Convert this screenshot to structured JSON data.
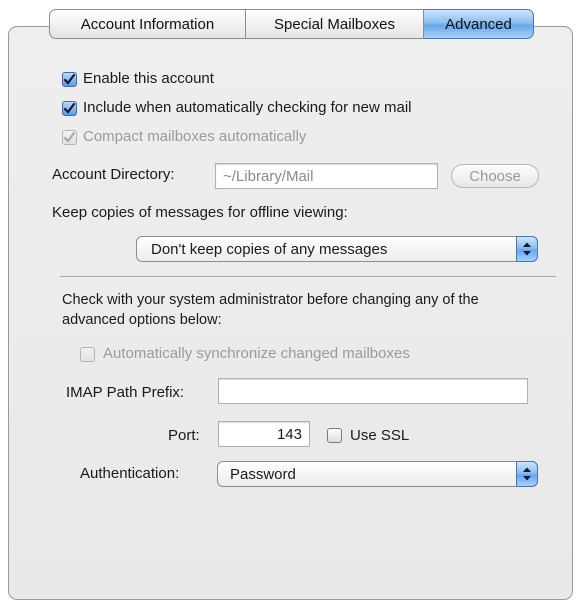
{
  "tabs": [
    {
      "label": "Account Information",
      "active": false
    },
    {
      "label": "Special Mailboxes",
      "active": false
    },
    {
      "label": "Advanced",
      "active": true
    }
  ],
  "options": {
    "enable_account": {
      "label": "Enable this account",
      "checked": true
    },
    "include_auto_check": {
      "label": "Include when automatically checking for new mail",
      "checked": true
    },
    "compact_mailboxes": {
      "label": "Compact mailboxes automatically",
      "checked": true,
      "disabled": true
    }
  },
  "account_directory": {
    "label": "Account Directory:",
    "value": "~/Library/Mail",
    "choose_button": "Choose"
  },
  "offline": {
    "label": "Keep copies of messages for offline viewing:",
    "selected": "Don't keep copies of any messages"
  },
  "advanced": {
    "warning": "Check with your system administrator before changing any of the advanced options below:",
    "auto_sync": {
      "label": "Automatically synchronize changed mailboxes",
      "checked": false,
      "disabled": true
    },
    "imap_prefix": {
      "label": "IMAP Path Prefix:",
      "value": ""
    },
    "port": {
      "label": "Port:",
      "value": "143"
    },
    "use_ssl": {
      "label": "Use SSL",
      "checked": false
    },
    "authentication": {
      "label": "Authentication:",
      "selected": "Password"
    }
  },
  "colors": {
    "accent": "#6aa6ea",
    "panel": "#ececec",
    "disabled_text": "#9a9a9a"
  }
}
